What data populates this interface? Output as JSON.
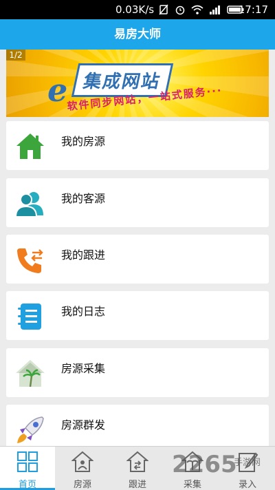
{
  "statusbar": {
    "net_speed": "0.03K/s",
    "time": "17:17"
  },
  "app": {
    "title": "易房大师"
  },
  "banner": {
    "counter": "1/2",
    "headline": "集成网站",
    "slogan": "软件同步网站，一站式服务···",
    "e_letter": "e"
  },
  "menu": [
    {
      "label": "我的房源",
      "icon": "house-icon"
    },
    {
      "label": "我的客源",
      "icon": "people-icon"
    },
    {
      "label": "我的跟进",
      "icon": "phone-icon"
    },
    {
      "label": "我的日志",
      "icon": "notebook-icon"
    },
    {
      "label": "房源采集",
      "icon": "house-palm-icon"
    },
    {
      "label": "房源群发",
      "icon": "rocket-icon"
    }
  ],
  "tabs": [
    {
      "label": "首页",
      "active": true
    },
    {
      "label": "房源",
      "active": false
    },
    {
      "label": "跟进",
      "active": false
    },
    {
      "label": "采集",
      "active": false
    },
    {
      "label": "录入",
      "active": false
    }
  ],
  "watermark": {
    "main": "2265",
    "sub": "手游网"
  },
  "colors": {
    "accent": "#1ea6eb",
    "tab_active": "#1e9ee0",
    "house_green": "#3ca63c",
    "people_teal": "#26aec0",
    "phone_orange": "#f07c1e",
    "notebook_blue": "#1fa0e0"
  }
}
